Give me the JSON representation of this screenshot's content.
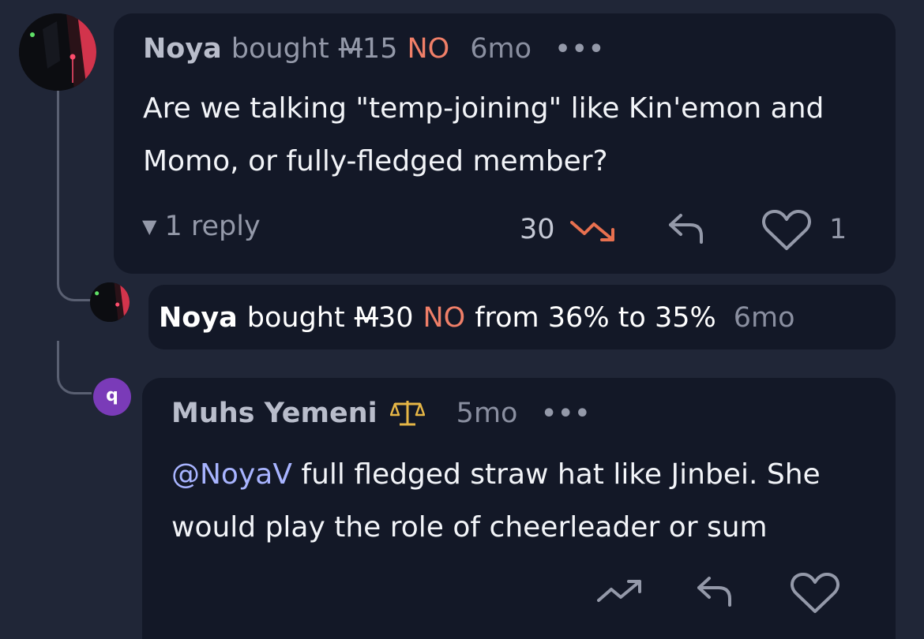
{
  "comments": [
    {
      "author": "Noya",
      "action": "bought",
      "amount": "M15",
      "outcome": "NO",
      "time": "6mo",
      "text": "Are we talking \"temp-joining\" like Kin'emon and Momo, or fully-fledged member?",
      "reply_toggle": "1 reply",
      "score": "30",
      "like_count": "1"
    }
  ],
  "trade": {
    "author": "Noya",
    "action": "bought",
    "amount": "M30",
    "outcome": "NO",
    "from_to": "from 36% to 35%",
    "time": "6mo"
  },
  "reply": {
    "author": "Muhs Yemeni",
    "avatar_letter": "q",
    "time": "5mo",
    "mention": "@NoyaV",
    "text": " full fledged straw hat like Jinbei. She would play the role of cheerleader or sum"
  },
  "icons": {
    "menu": "more-dots-icon",
    "trend_down": "trending-down-icon",
    "trend_up": "trending-up-icon",
    "reply": "reply-arrow-icon",
    "like": "heart-icon",
    "moderator": "scale-icon"
  },
  "colors": {
    "background": "#202637",
    "card": "#131827",
    "no": "#f07f68",
    "mention": "#a8b4ff",
    "trend_down": "#e8704f",
    "badge": "#e6b646",
    "avatar_q": "#7a3bb8"
  }
}
